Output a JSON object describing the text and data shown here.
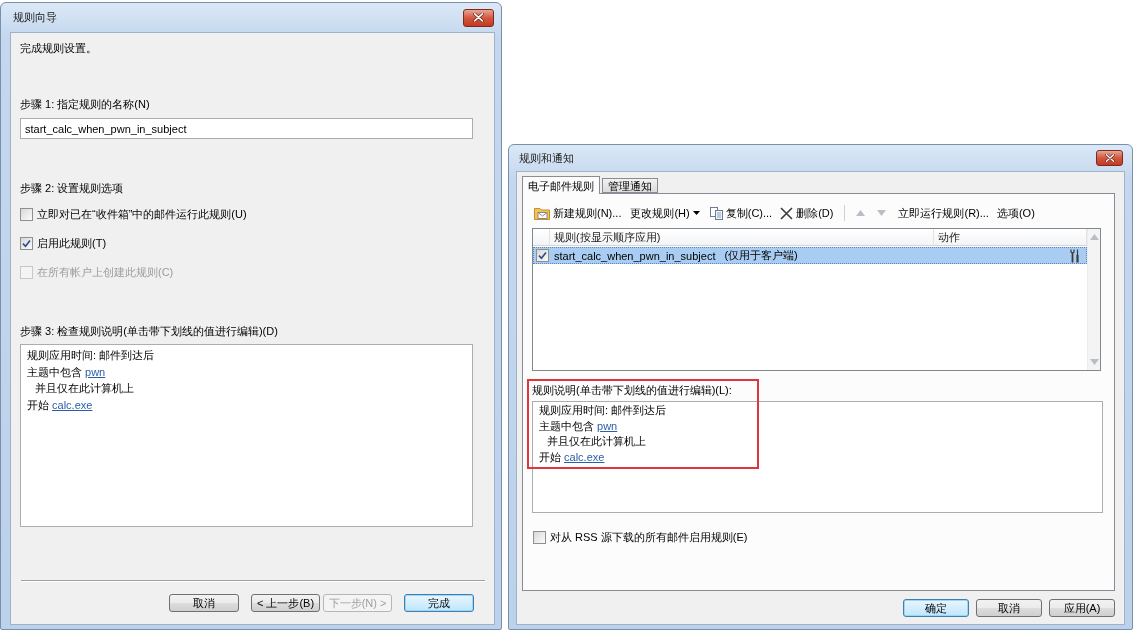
{
  "rules_wizard": {
    "window": {
      "title": "规则向导"
    },
    "intro": "完成规则设置。",
    "step_1": {
      "label": "步骤 1: 指定规则的名称(N)",
      "rule_name": "start_calc_when_pwn_in_subject"
    },
    "step_2": {
      "label": "步骤 2: 设置规则选项",
      "options": [
        {
          "label": "立即对已在“收件箱”中的邮件运行此规则(U)",
          "checked": false,
          "disabled": false
        },
        {
          "label": "启用此规则(T)",
          "checked": true,
          "disabled": false
        },
        {
          "label": "在所有帐户上创建此规则(C)",
          "checked": false,
          "disabled": true
        }
      ]
    },
    "step_3": {
      "label": "步骤 3: 检查规则说明(单击带下划线的值进行编辑)(D)",
      "description": [
        {
          "text": "规则应用时间: 邮件到达后"
        },
        {
          "text": "主题中包含",
          "link": "pwn",
          "children": [
            {
              "text": "并且仅在此计算机上"
            }
          ]
        },
        {
          "text": "开始",
          "link": "calc.exe"
        }
      ]
    },
    "buttons": [
      {
        "label": "取消",
        "default": false,
        "disabled": false
      },
      {
        "label": "< 上一步(B)",
        "default": false,
        "disabled": false
      },
      {
        "label": "下一步(N) >",
        "default": false,
        "disabled": true
      },
      {
        "label": "完成",
        "default": true,
        "disabled": false
      }
    ]
  },
  "rules_and_alerts": {
    "window": {
      "title": "规则和通知"
    },
    "tabs": [
      {
        "label": "电子邮件规则",
        "selected": true
      },
      {
        "label": "管理通知",
        "selected": false
      }
    ],
    "toolbar": {
      "new_rule": {
        "label": "新建规则(N)..."
      },
      "change_rule": {
        "label": "更改规则(H)"
      },
      "copy": {
        "label": "复制(C)..."
      },
      "delete": {
        "label": "删除(D)"
      },
      "move_up": {
        "disabled": true
      },
      "move_down": {
        "disabled": true
      },
      "run_now": {
        "label": "立即运行规则(R)..."
      },
      "options": {
        "label": "选项(O)"
      }
    },
    "rules_table": {
      "columns": [
        "规则(按显示顺序应用)",
        "动作"
      ],
      "rows": [
        {
          "name": "start_calc_when_pwn_in_subject",
          "note": "(仅用于客户端)",
          "checked": true,
          "selected": true
        }
      ]
    },
    "description_label": "规则说明(单击带下划线的值进行编辑)(L):",
    "description": [
      {
        "text": "规则应用时间: 邮件到达后"
      },
      {
        "text": "主题中包含",
        "link": "pwn",
        "children": [
          {
            "text": "并且仅在此计算机上"
          }
        ]
      },
      {
        "text": "开始",
        "link": "calc.exe"
      }
    ],
    "rss_option": {
      "label": "对从 RSS 源下载的所有邮件启用规则(E)",
      "checked": false
    },
    "buttons": [
      {
        "label": "确定",
        "default": true,
        "disabled": false
      },
      {
        "label": "取消",
        "default": false,
        "disabled": false
      },
      {
        "label": "应用(A)",
        "default": false,
        "disabled": false
      }
    ]
  }
}
